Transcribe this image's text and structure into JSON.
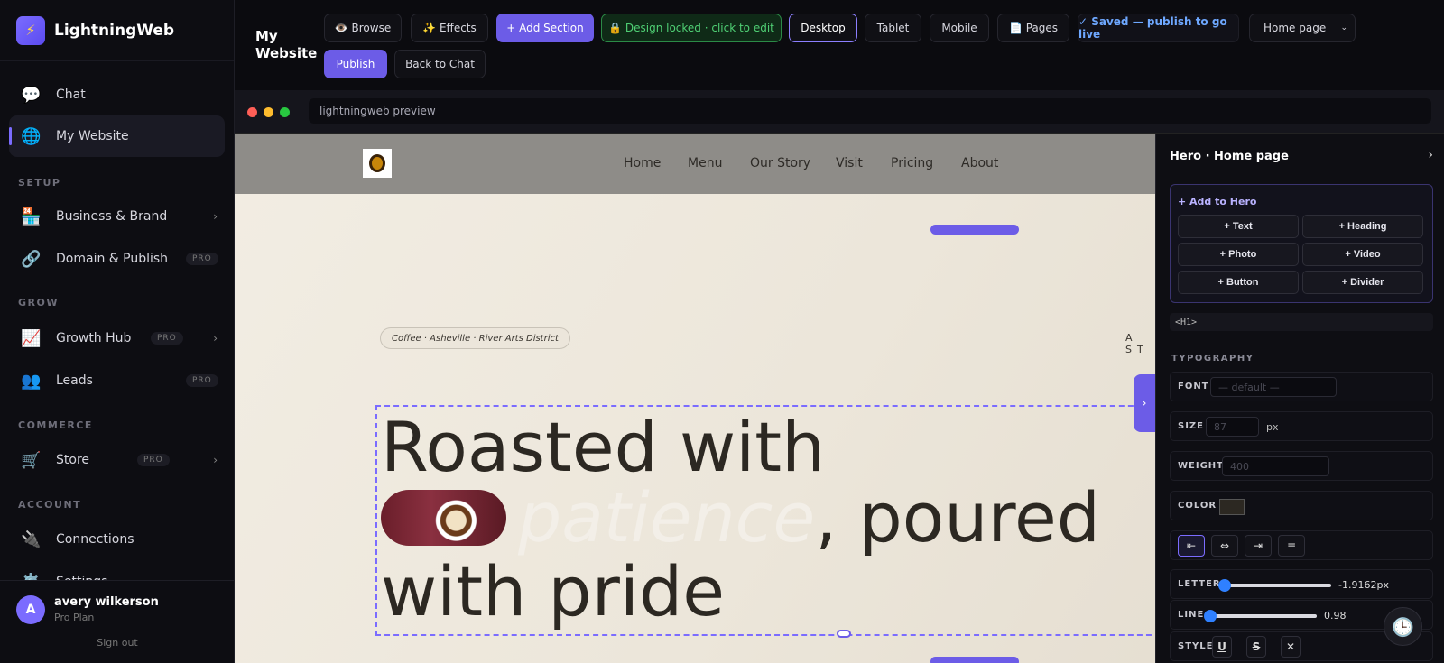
{
  "brand": {
    "name": "LightningWeb",
    "logo_icon": "lightning-bolt"
  },
  "sidebar": {
    "items": [
      {
        "label": "Chat",
        "icon": "speech-bubble"
      },
      {
        "label": "My Website",
        "icon": "globe"
      },
      {
        "label": "Business & Brand",
        "icon": "briefcase",
        "chevron": "›"
      },
      {
        "label": "Domain & Publish",
        "icon": "link",
        "badge": "PRO"
      },
      {
        "label": "Growth Hub",
        "icon": "chart",
        "badge": "PRO",
        "chevron": "›"
      },
      {
        "label": "Leads",
        "icon": "people",
        "badge": "PRO"
      },
      {
        "label": "Store",
        "icon": "cart",
        "badge": "PRO",
        "chevron": "›"
      },
      {
        "label": "Connections",
        "icon": "plug"
      },
      {
        "label": "Settings",
        "icon": "gear"
      }
    ],
    "sections": {
      "setup": "SETUP",
      "grow": "GROW",
      "commerce": "COMMERCE",
      "account": "ACCOUNT"
    }
  },
  "user": {
    "name": "avery wilkerson",
    "plan": "Pro Plan",
    "initial": "A",
    "signout": "Sign out"
  },
  "toolbar": {
    "site_title": "My Website",
    "browse": "👁️ Browse",
    "effects": "✨ Effects",
    "add_section": "+ Add Section",
    "design_locked": "🔒 Design locked · click to edit",
    "desktop": "Desktop",
    "tablet": "Tablet",
    "mobile": "Mobile",
    "pages": "📄 Pages",
    "saved": "✓ Saved — publish to go live",
    "page_select": "Home page",
    "publish": "Publish",
    "back_to_chat": "Back to Chat"
  },
  "preview": {
    "url": "lightningweb preview"
  },
  "site": {
    "nav": [
      "Home",
      "Menu",
      "Our Story",
      "Visit",
      "Pricing",
      "About"
    ],
    "pill": "Coffee · Asheville · River Arts District",
    "spaced_text": "A ST",
    "headline": {
      "line1": "Roasted with",
      "italic": "patience",
      "line2_rest": ", poured",
      "line3": "with pride"
    }
  },
  "panel": {
    "title": "Hero · Home page",
    "add_title": "+ Add to Hero",
    "add_buttons": [
      "+ Text",
      "+ Heading",
      "+ Photo",
      "+ Video",
      "+ Button",
      "+ Divider"
    ],
    "tag": "<H1>",
    "section": "TYPOGRAPHY",
    "font_label": "FONT",
    "font_placeholder": "— default —",
    "size_label": "SIZE",
    "size_placeholder": "87",
    "size_unit": "px",
    "weight_label": "WEIGHT",
    "weight_placeholder": "400",
    "color_label": "COLOR",
    "color_value": "#2c2822",
    "letter_label": "LETTER",
    "letter_value": "-1.9162px",
    "letter_level": 0.0,
    "line_label": "LINE",
    "line_value": "0.98",
    "line_level": 0.0,
    "style_label": "STYLE"
  }
}
